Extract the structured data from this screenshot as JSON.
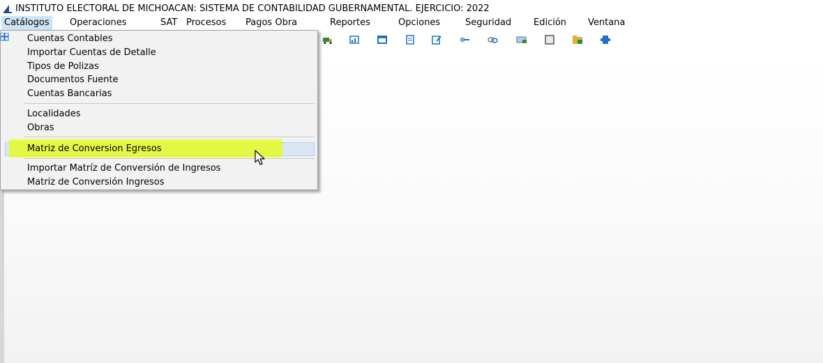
{
  "window": {
    "title": "INSTITUTO ELECTORAL DE MICHOACAN: SISTEMA DE CONTABILIDAD GUBERNAMENTAL. EJERCICIO: 2022"
  },
  "menubar": {
    "items": [
      {
        "label": "Catálogos"
      },
      {
        "label": "Operaciones"
      },
      {
        "label": "SAT"
      },
      {
        "label": "Procesos"
      },
      {
        "label": "Pagos Obra"
      },
      {
        "label": "Reportes"
      },
      {
        "label": "Opciones"
      },
      {
        "label": "Seguridad"
      },
      {
        "label": "Edición"
      },
      {
        "label": "Ventana"
      }
    ]
  },
  "dropdown": {
    "items": [
      {
        "label": "Cuentas Contables"
      },
      {
        "label": "Importar Cuentas de Detalle"
      },
      {
        "label": "Tipos de Polizas"
      },
      {
        "label": "Documentos Fuente"
      },
      {
        "label": "Cuentas Bancarias"
      },
      {
        "label": "Localidades"
      },
      {
        "label": "Obras"
      },
      {
        "label": "Matriz de Conversion Egresos"
      },
      {
        "label": "Importar Matríz de Conversión de Ingresos"
      },
      {
        "label": "Matriz de Conversión Ingresos"
      }
    ],
    "hovered_item": "Matriz de Conversion Egresos"
  },
  "toolbar": {
    "icons": [
      "truck-icon",
      "chart-icon",
      "window-icon",
      "document-icon",
      "edit-document-icon",
      "key-icon",
      "chain-icon",
      "money-icon",
      "notebook-icon",
      "folder-icon",
      "connector-icon"
    ]
  },
  "colors": {
    "menu_active": "#cce4f7",
    "hover_bg": "#dbe6f4",
    "highlighter": "#e6ff00",
    "toolbar_blue": "#1a73c8"
  }
}
